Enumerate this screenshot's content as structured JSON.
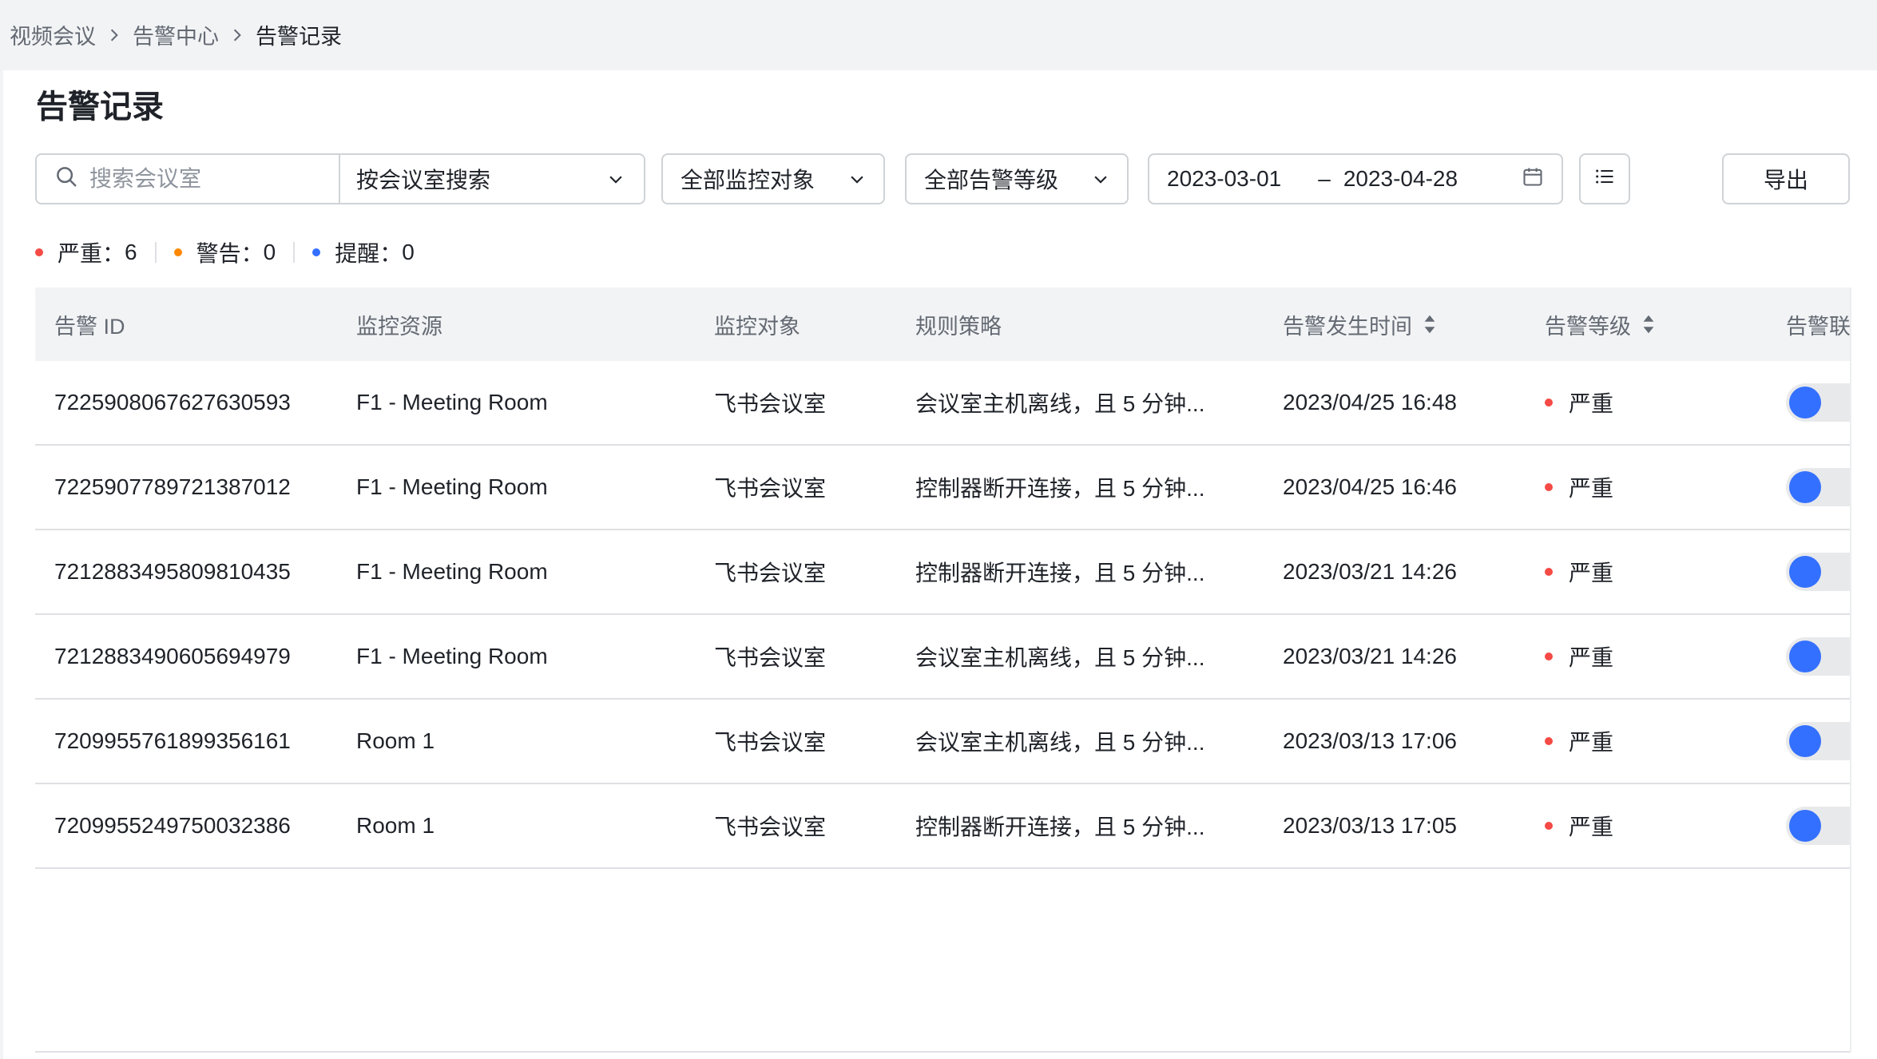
{
  "breadcrumb": {
    "items": [
      "视频会议",
      "告警中心"
    ],
    "current": "告警记录"
  },
  "page": {
    "title": "告警记录"
  },
  "filters": {
    "search_placeholder": "搜索会议室",
    "search_value": "",
    "search_mode": "按会议室搜索",
    "monitor_target": "全部监控对象",
    "alert_level": "全部告警等级",
    "date_start": "2023-03-01",
    "date_sep": "–",
    "date_end": "2023-04-28",
    "export_label": "导出"
  },
  "stats": [
    {
      "label": "严重：",
      "count": "6",
      "color": "#f54a45"
    },
    {
      "label": "警告：",
      "count": "0",
      "color": "#ff8800"
    },
    {
      "label": "提醒：",
      "count": "0",
      "color": "#3370ff"
    }
  ],
  "table": {
    "columns": [
      "告警 ID",
      "监控资源",
      "监控对象",
      "规则策略",
      "告警发生时间",
      "告警等级",
      "告警联"
    ],
    "rows": [
      {
        "id": "7225908067627630593",
        "resource": "F1 - Meeting Room",
        "object": "飞书会议室",
        "rule": "会议室主机离线，且 5 分钟...",
        "time": "2023/04/25 16:48",
        "level": "严重"
      },
      {
        "id": "7225907789721387012",
        "resource": "F1 - Meeting Room",
        "object": "飞书会议室",
        "rule": "控制器断开连接，且 5 分钟...",
        "time": "2023/04/25 16:46",
        "level": "严重"
      },
      {
        "id": "7212883495809810435",
        "resource": "F1 - Meeting Room",
        "object": "飞书会议室",
        "rule": "控制器断开连接，且 5 分钟...",
        "time": "2023/03/21 14:26",
        "level": "严重"
      },
      {
        "id": "7212883490605694979",
        "resource": "F1 - Meeting Room",
        "object": "飞书会议室",
        "rule": "会议室主机离线，且 5 分钟...",
        "time": "2023/03/21 14:26",
        "level": "严重"
      },
      {
        "id": "7209955761899356161",
        "resource": "Room 1",
        "object": "飞书会议室",
        "rule": "会议室主机离线，且 5 分钟...",
        "time": "2023/03/13 17:06",
        "level": "严重"
      },
      {
        "id": "7209955249750032386",
        "resource": "Room 1",
        "object": "飞书会议室",
        "rule": "控制器断开连接，且 5 分钟...",
        "time": "2023/03/13 17:05",
        "level": "严重"
      }
    ]
  },
  "colors": {
    "accent": "#3370ff",
    "critical": "#f54a45",
    "warning": "#ff8800"
  },
  "icons": {
    "breadcrumb_sep": "chevron-right-icon",
    "search": "search-icon",
    "dropdown": "chevron-down-icon",
    "calendar": "calendar-icon",
    "list": "list-icon",
    "sort": "sort-icon"
  }
}
